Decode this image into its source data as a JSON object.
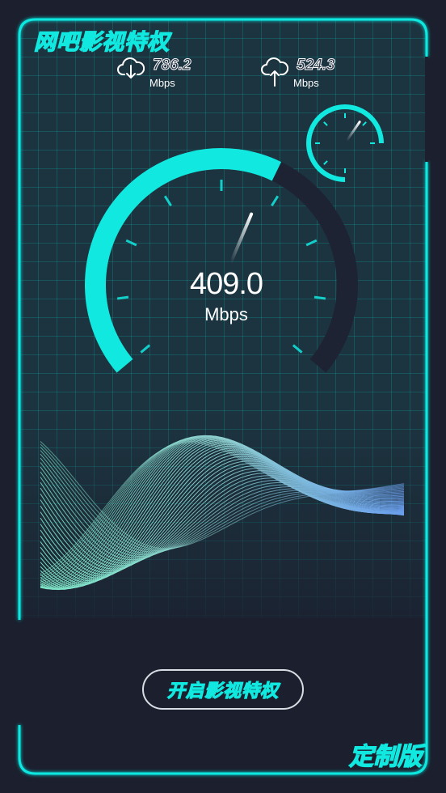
{
  "app": {
    "title": "网吧影视特权",
    "edition": "定制版"
  },
  "stats": {
    "download": {
      "value": "786.2",
      "unit": "Mbps",
      "icon": "cloud-download-icon"
    },
    "upload": {
      "value": "524.3",
      "unit": "Mbps",
      "icon": "cloud-upload-icon"
    }
  },
  "speedometer": {
    "value": "409.0",
    "unit": "Mbps",
    "fill_fraction": 0.6
  },
  "mini_gauge": {
    "fill_fraction": 0.35
  },
  "cta": {
    "label": "开启影视特权"
  },
  "colors": {
    "accent": "#11e8e0",
    "background": "#1b1f2e",
    "grid": "#1c3440",
    "gauge_track": "#1e2333",
    "wave_start": "#7ee8c8",
    "wave_end": "#6a9ff0"
  }
}
